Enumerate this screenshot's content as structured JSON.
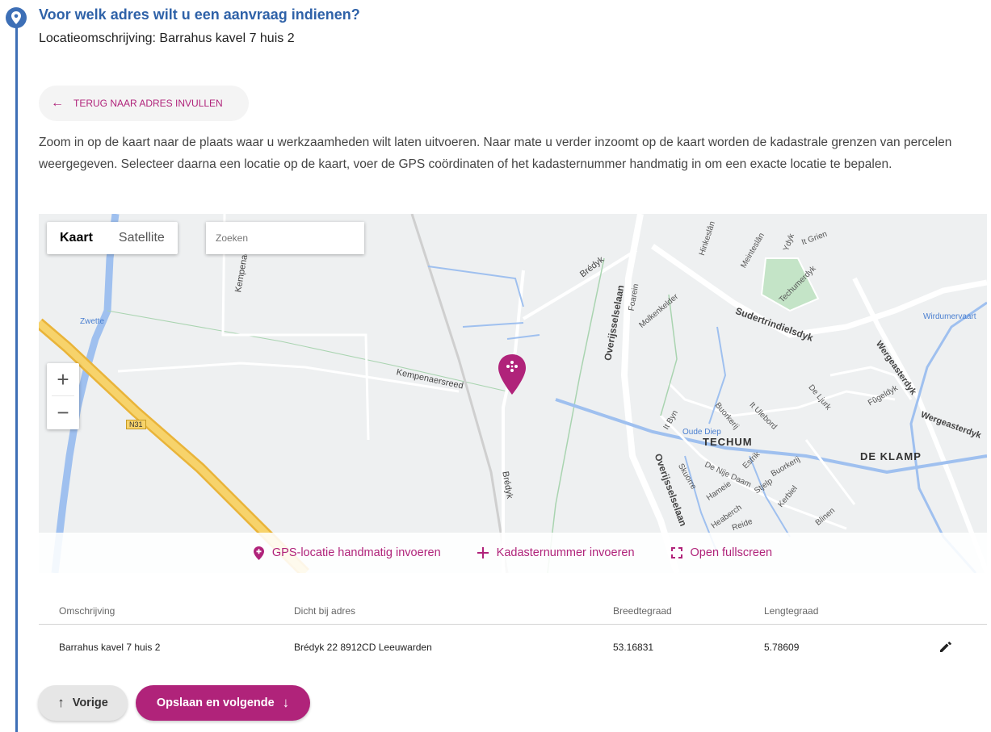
{
  "question": {
    "icon": "location-pin-icon",
    "title": "Voor welk adres wilt u een aanvraag indienen?",
    "subtitle": "Locatieomschrijving: Barrahus kavel 7 huis 2"
  },
  "back_button": {
    "label": "TERUG NAAR ADRES INVULLEN",
    "icon": "arrow-left-icon"
  },
  "intro_text": "Zoom in op de kaart naar de plaats waar u werkzaamheden wilt laten uitvoeren. Naar mate u verder inzoomt op de kaart worden de kadastrale grenzen van percelen weergegeven. Selecteer daarna een locatie op de kaart, voer de GPS coördinaten of het kadasternummer handmatig in om een exacte locatie te bepalen.",
  "map": {
    "type_buttons": {
      "map": "Kaart",
      "satellite": "Satellite",
      "active": "Kaart"
    },
    "search_placeholder": "Zoeken",
    "zoom_in": "+",
    "zoom_out": "−",
    "labels": {
      "zwette": "Zwette",
      "kempenaersreed": "Kempenaersreed",
      "kempenaersreed_short": "Kempenae",
      "n31": "N31",
      "bredyk_top": "Brédyk",
      "bredyk_bottom": "Brédyk",
      "overijsselselaan_top": "Overijsselselaan",
      "overijsselselaan_bottom": "Overijsselselaan",
      "foarein": "Foarein",
      "molkenkelder": "Molkenkelder",
      "sudertrindielsdyk": "Sudertrindielsdyk",
      "hinkeslan": "Hinkeslân",
      "meinteslan": "Meinteslân",
      "ydyk": "Ydyk",
      "it_grien": "It Grien",
      "techumerdyk": "Techumerdyk",
      "wirdumervaart": "Wirdumervaart",
      "wergeasterdyk": "Wergeasterdyk",
      "wergeasterdyk2": "Wergeasterdyk",
      "fugeldyk": "Fûgeldyk",
      "de_ljurk": "De Ljurk",
      "it_ulebord": "It Ulebord",
      "buorkerij": "Buorkerij",
      "it_byn": "It Byn",
      "oude_diep": "Oude Diep",
      "techum": "TECHUM",
      "de_klamp": "DE KLAMP",
      "de_nije_daam": "De Nije Daam",
      "estrik": "Estrik",
      "buorkerij2": "Buorkerij",
      "skuorre": "Skuorre",
      "hameie": "Hameie",
      "stjelp": "Stjelp",
      "kerbiel": "Kerbiel",
      "heaberch": "Heaberch",
      "blinen": "Blinen",
      "reide": "Reide"
    },
    "actions": {
      "gps": "GPS-locatie handmatig invoeren",
      "kadaster": "Kadasternummer invoeren",
      "fullscreen": "Open fullscreen"
    },
    "marker_icon": "map-marker-icon"
  },
  "table": {
    "headers": [
      "Omschrijving",
      "Dicht bij adres",
      "Breedtegraad",
      "Lengtegraad"
    ],
    "rows": [
      {
        "omschrijving": "Barrahus kavel 7 huis 2",
        "adres": "Brédyk 22 8912CD Leeuwarden",
        "breedtegraad": "53.16831",
        "lengtegraad": "5.78609",
        "action_icon": "pencil-icon"
      }
    ]
  },
  "nav": {
    "prev": "Vorige",
    "next": "Opslaan en volgende"
  },
  "colors": {
    "accent": "#b0237a",
    "primary_blue": "#3d6fb6",
    "map_water": "#9fc0ef",
    "map_road": "#ffffff",
    "highway": "#f5c243"
  }
}
